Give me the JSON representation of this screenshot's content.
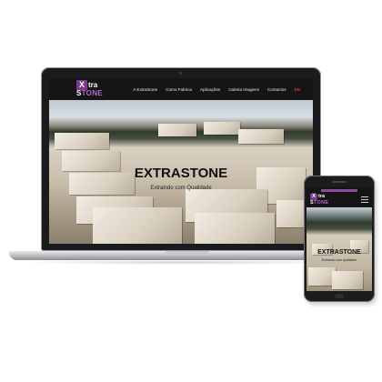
{
  "site": {
    "logo": {
      "badge": "X",
      "top": "tra",
      "bottom_prefix": "S",
      "bottom_accent": "TONE"
    },
    "menu": [
      "A ExtraStone",
      "Como Fabrica",
      "Aplicações",
      "Galeria Imagens",
      "Contactos"
    ],
    "language": "EN",
    "hero_title": "EXTRASTONE",
    "hero_subtitle": "Extraindo com Qualidade"
  },
  "phone_site": {
    "logo": {
      "badge": "X",
      "top": "tra",
      "bottom_prefix": "S",
      "bottom_accent": "TONE"
    },
    "hero_title": "EXTRASTONE",
    "hero_subtitle": "Extraindo com qualidade"
  },
  "colors": {
    "brand_purple": "#7b3a8c",
    "nav_background": "#151515"
  }
}
